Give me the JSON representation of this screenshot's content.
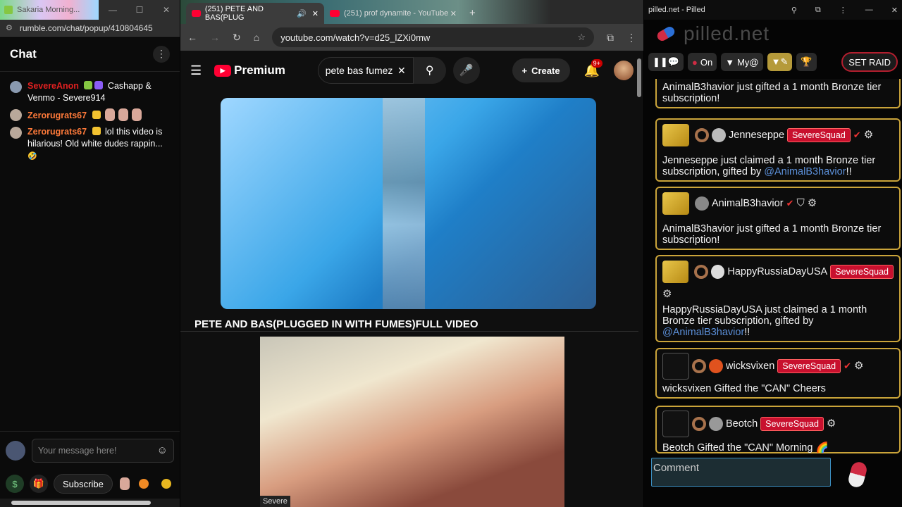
{
  "rumble": {
    "tab_title": "Sakaria Morning...",
    "url": "rumble.com/chat/popup/410804645",
    "chat_title": "Chat",
    "messages": [
      {
        "name": "SevereAnon",
        "name_color": "#e02020",
        "text": "Cashapp & Venmo - Severe914"
      },
      {
        "name": "Zerorugrats67",
        "name_color": "#ff7a3a",
        "text": ""
      },
      {
        "name": "Zerorugrats67",
        "name_color": "#ff7a3a",
        "text": "lol this video is hilarious! Old white dudes rappin..."
      }
    ],
    "input_placeholder": "Your message here!",
    "subscribe_label": "Subscribe"
  },
  "youtube": {
    "tabs": [
      {
        "label": "(251) PETE AND BAS(PLUG"
      },
      {
        "label": "(251) prof dynamite - YouTube"
      }
    ],
    "url": "youtube.com/watch?v=d25_lZXi0mw",
    "logo_text": "Premium",
    "search_value": "pete bas fumez",
    "create_label": "Create",
    "notif_count": "9+",
    "video_title": "PETE AND BAS(PLUGGED IN WITH FUMES)FULL VIDEO",
    "video2_label": "Severe"
  },
  "pilled": {
    "window_title": "pilled.net - Pilled",
    "brand": "pilled.net",
    "toolbar": {
      "on_label": "On",
      "my_label": "My@",
      "raid_label": "SET RAID"
    },
    "cards": [
      {
        "text": "AnimalB3havior just gifted a 1 month Bronze tier subscription!"
      },
      {
        "user": "Jenneseppe",
        "badge": "SevereSquad",
        "text_pre": "Jenneseppe just claimed a 1 month Bronze tier subscription, gifted by ",
        "mention": "@AnimalB3havior",
        "text_post": "!!"
      },
      {
        "user": "AnimalB3havior",
        "text": "AnimalB3havior just gifted a 1 month Bronze tier subscription!"
      },
      {
        "user": "HappyRussiaDayUSA",
        "badge": "SevereSquad",
        "text_pre": "HappyRussiaDayUSA just claimed a 1 month Bronze tier subscription, gifted by ",
        "mention": "@AnimalB3havior",
        "text_post": "!!"
      },
      {
        "user": "wicksvixen",
        "badge": "SevereSquad",
        "text": "wicksvixen Gifted the \"CAN\" Cheers"
      },
      {
        "user": "Beotch",
        "badge": "SevereSquad",
        "text": "Beotch Gifted the \"CAN\" Morning"
      }
    ],
    "comment_placeholder": "Comment"
  }
}
